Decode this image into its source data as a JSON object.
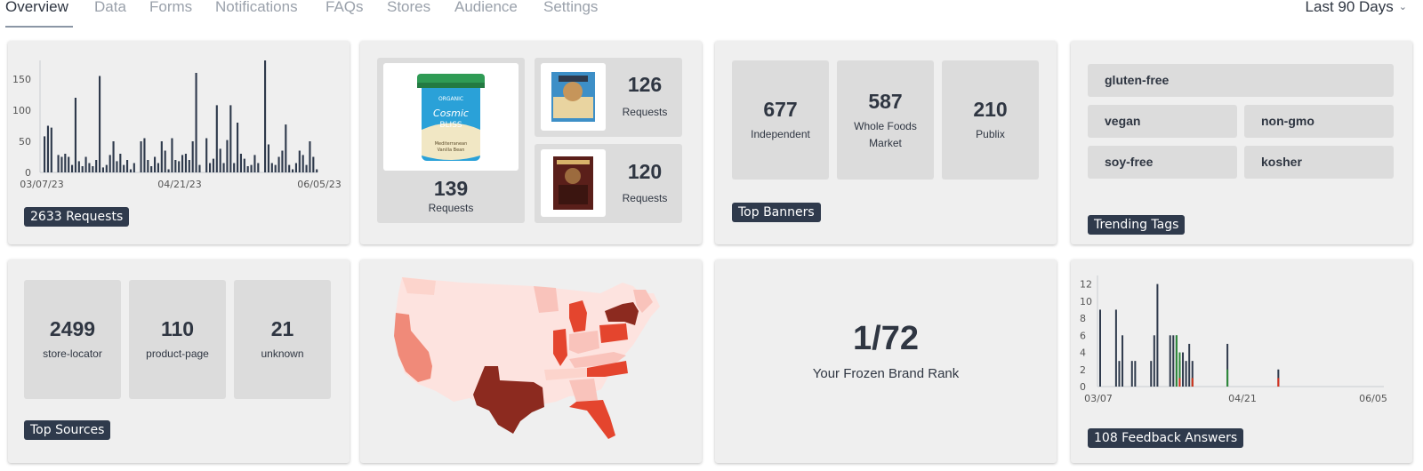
{
  "nav": {
    "tabs": [
      "Overview",
      "Data",
      "Forms",
      "Notifications",
      "FAQs",
      "Stores",
      "Audience",
      "Settings"
    ],
    "active_tab": "Overview",
    "date_range": "Last 90 Days"
  },
  "requests_card": {
    "badge": "2633 Requests",
    "chart_data": {
      "type": "bar",
      "x_tick_labels": [
        "03/07/23",
        "04/21/23",
        "06/05/23"
      ],
      "y_ticks": [
        0,
        50,
        100,
        150
      ],
      "ylim": [
        0,
        180
      ],
      "values": [
        58,
        75,
        72,
        0,
        28,
        25,
        30,
        25,
        12,
        120,
        18,
        10,
        25,
        15,
        10,
        20,
        155,
        8,
        12,
        28,
        50,
        18,
        30,
        12,
        20,
        5,
        15,
        0,
        50,
        55,
        20,
        10,
        25,
        15,
        50,
        35,
        5,
        55,
        20,
        18,
        28,
        30,
        20,
        50,
        160,
        12,
        0,
        55,
        15,
        22,
        108,
        38,
        15,
        52,
        108,
        15,
        80,
        30,
        22,
        10,
        12,
        28,
        15,
        0,
        180,
        45,
        15,
        12,
        25,
        35,
        77,
        12,
        5,
        15,
        35,
        28,
        12,
        50,
        25,
        5
      ]
    }
  },
  "products_card": {
    "main": {
      "value": "139",
      "label": "Requests",
      "image": "cosmic-bliss-ice-cream-pint"
    },
    "items": [
      {
        "value": "126",
        "label": "Requests",
        "image": "ice-cream-sandwich-box"
      },
      {
        "value": "120",
        "label": "Requests",
        "image": "chocolate-ice-cream-box"
      }
    ]
  },
  "banners_card": {
    "badge": "Top Banners",
    "tiles": [
      {
        "value": "677",
        "label": "Independent"
      },
      {
        "value": "587",
        "label": "Whole Foods Market"
      },
      {
        "value": "210",
        "label": "Publix"
      }
    ]
  },
  "tags_card": {
    "badge": "Trending Tags",
    "tags": [
      "gluten-free",
      "vegan",
      "non-gmo",
      "soy-free",
      "kosher"
    ]
  },
  "sources_card": {
    "badge": "Top Sources",
    "tiles": [
      {
        "value": "2499",
        "label": "store-locator"
      },
      {
        "value": "110",
        "label": "product-page"
      },
      {
        "value": "21",
        "label": "unknown"
      }
    ]
  },
  "map_card": {
    "colors": {
      "light": "#fde3df",
      "pale": "#f9c3bb",
      "mid": "#f08a79",
      "strong": "#e4452e",
      "dark": "#8c2a1f"
    }
  },
  "rank_card": {
    "value": "1/72",
    "label": "Your Frozen Brand Rank"
  },
  "feedback_card": {
    "badge": "108 Feedback Answers",
    "chart_data": {
      "type": "bar",
      "x_tick_labels": [
        "03/07",
        "04/21",
        "06/05"
      ],
      "y_ticks": [
        0,
        2,
        4,
        6,
        8,
        10,
        12
      ],
      "ylim": [
        0,
        13
      ],
      "series": [
        {
          "color": "#2f3a4c",
          "bars": [
            [
              0,
              9
            ],
            [
              5,
              9
            ],
            [
              6,
              3
            ],
            [
              7,
              6
            ],
            [
              10,
              3
            ],
            [
              11,
              3
            ],
            [
              16,
              3
            ],
            [
              17,
              6
            ],
            [
              18,
              12
            ],
            [
              22,
              6
            ],
            [
              23,
              6
            ],
            [
              24,
              6
            ],
            [
              25,
              3
            ],
            [
              26,
              4
            ],
            [
              27,
              3
            ],
            [
              28,
              5
            ],
            [
              29,
              3
            ],
            [
              40,
              5
            ],
            [
              56,
              2
            ]
          ]
        },
        {
          "color": "#2e8b3a",
          "bars": [
            [
              24,
              6
            ],
            [
              25,
              4
            ],
            [
              29,
              1
            ],
            [
              40,
              2
            ]
          ]
        },
        {
          "color": "#d6301e",
          "bars": [
            [
              25,
              1
            ],
            [
              29,
              1
            ],
            [
              56,
              1
            ]
          ]
        }
      ],
      "days": 90
    }
  }
}
